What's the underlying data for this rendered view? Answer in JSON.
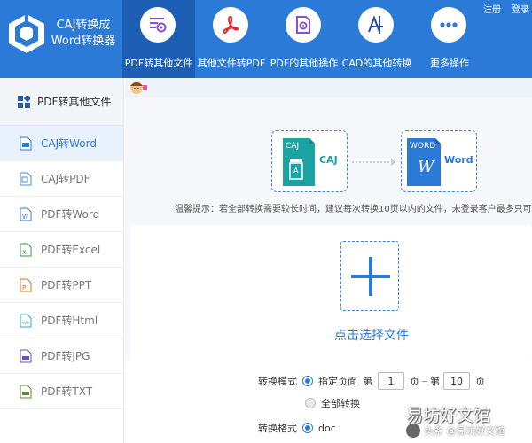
{
  "app": {
    "title_line1": "CAJ转换成",
    "title_line2": "Word转换器"
  },
  "top_links": {
    "register": "注册",
    "login": "登录"
  },
  "nav": [
    {
      "label": "PDF转其他文件",
      "icon": "pdf-gear-icon",
      "active": true
    },
    {
      "label": "其他文件转PDF",
      "icon": "acrobat-icon",
      "active": false
    },
    {
      "label": "PDF的其他操作",
      "icon": "pdf-settings-icon",
      "active": false
    },
    {
      "label": "CAD的其他转换",
      "icon": "cad-icon",
      "active": false
    },
    {
      "label": "更多操作",
      "icon": "more-dots-icon",
      "active": false
    }
  ],
  "sidebar": {
    "header": "PDF转其他文件",
    "items": [
      {
        "label": "CAJ转Word",
        "icon": "caj-file-icon",
        "active": true
      },
      {
        "label": "CAJ转PDF",
        "icon": "caj-pdf-file-icon",
        "active": false
      },
      {
        "label": "PDF转Word",
        "icon": "word-file-icon",
        "active": false
      },
      {
        "label": "PDF转Excel",
        "icon": "excel-file-icon",
        "active": false
      },
      {
        "label": "PDF转PPT",
        "icon": "ppt-file-icon",
        "active": false
      },
      {
        "label": "PDF转Html",
        "icon": "html-file-icon",
        "active": false
      },
      {
        "label": "PDF转JPG",
        "icon": "jpg-file-icon",
        "active": false
      },
      {
        "label": "PDF转TXT",
        "icon": "txt-file-icon",
        "active": false
      }
    ]
  },
  "conversion": {
    "from_tag": "CAJ",
    "from_label": "CAJ",
    "to_tag": "WORD",
    "to_letter": "W",
    "to_label": "Word"
  },
  "tip": "温馨提示：若全部转换需要较长时间，建议每次转换10页以内的文件，未登录客户最多只可转换",
  "drop": {
    "choose_label": "点击选择文件"
  },
  "options": {
    "mode_label": "转换模式",
    "specified_pages": "指定页面",
    "page_prefix": "第",
    "from_page": "1",
    "page_suffix": "页",
    "to_page": "10",
    "all_convert": "全部转换",
    "format_label": "转换格式",
    "format_doc": "doc"
  },
  "watermark": {
    "big": "易坊好文馆",
    "small": "头条 @易坊好文馆"
  },
  "colors": {
    "primary": "#2b7ad8",
    "header_active": "#1d5fb5",
    "caj_teal": "#1aa3a0",
    "word_blue": "#2b7ad8"
  }
}
